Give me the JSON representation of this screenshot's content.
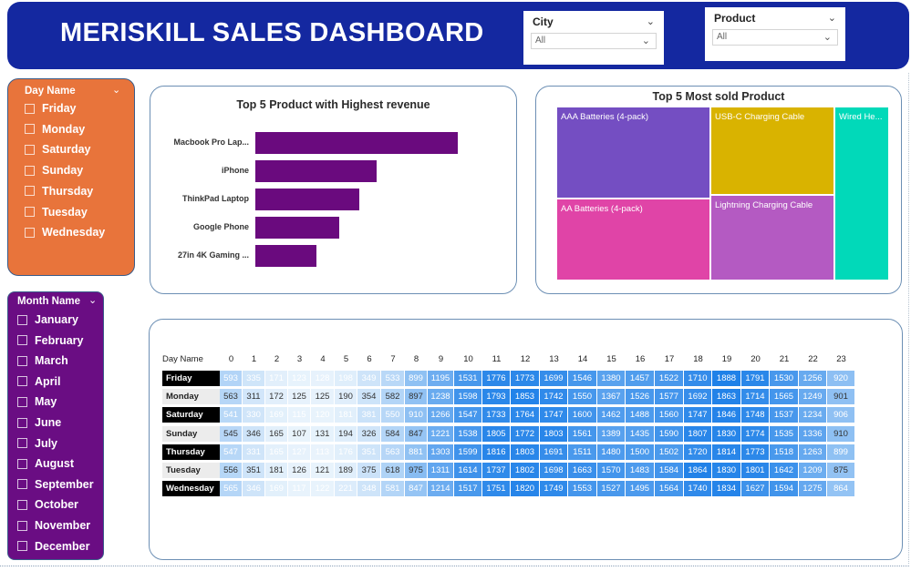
{
  "header": {
    "title": "MERISKILL SALES DASHBOARD"
  },
  "city_slicer": {
    "label": "City",
    "value": "All"
  },
  "product_slicer": {
    "label": "Product",
    "value": "All"
  },
  "day_slicer": {
    "title": "Day Name",
    "items": [
      "Friday",
      "Monday",
      "Saturday",
      "Sunday",
      "Thursday",
      "Tuesday",
      "Wednesday"
    ]
  },
  "month_slicer": {
    "title": "Month Name",
    "items": [
      "January",
      "February",
      "March",
      "April",
      "May",
      "June",
      "July",
      "August",
      "September",
      "October",
      "November",
      "December"
    ]
  },
  "bar_chart": {
    "title": "Top 5 Product with Highest revenue",
    "color": "#6a0a7e"
  },
  "treemap": {
    "title": "Top 5 Most sold Product"
  },
  "heatmap": {
    "corner_label": "Day Name"
  },
  "chart_data": [
    {
      "type": "bar",
      "title": "Top 5 Product with Highest revenue",
      "categories": [
        "Macbook Pro Lap...",
        "iPhone",
        "ThinkPad Laptop",
        "Google Phone",
        "27in 4K Gaming ..."
      ],
      "values": [
        8.0,
        4.8,
        4.1,
        3.3,
        2.4
      ],
      "xlim": [
        0,
        8.0
      ]
    },
    {
      "type": "treemap",
      "title": "Top 5 Most sold Product",
      "items": [
        {
          "name": "AAA Batteries (4-pack)",
          "color": "#744ec2"
        },
        {
          "name": "AA Batteries (4-pack)",
          "color": "#e044a7"
        },
        {
          "name": "USB-C Charging Cable",
          "color": "#d9b300"
        },
        {
          "name": "Lightning Charging Cable",
          "color": "#b45ac2"
        },
        {
          "name": "Wired He...",
          "color": "#01d9b9"
        }
      ]
    },
    {
      "type": "heatmap",
      "x": [
        "0",
        "1",
        "2",
        "3",
        "4",
        "5",
        "6",
        "7",
        "8",
        "9",
        "10",
        "11",
        "12",
        "13",
        "14",
        "15",
        "16",
        "17",
        "18",
        "19",
        "20",
        "21",
        "22",
        "23"
      ],
      "rows": [
        {
          "day": "Friday",
          "label_style": "dark",
          "values": [
            593,
            335,
            171,
            123,
            128,
            198,
            349,
            533,
            899,
            1195,
            1531,
            1776,
            1773,
            1699,
            1546,
            1380,
            1457,
            1522,
            1710,
            1888,
            1791,
            1530,
            1256,
            920
          ]
        },
        {
          "day": "Monday",
          "label_style": "light",
          "values": [
            563,
            311,
            172,
            125,
            125,
            190,
            354,
            582,
            897,
            1238,
            1598,
            1793,
            1853,
            1742,
            1550,
            1367,
            1526,
            1577,
            1692,
            1863,
            1714,
            1565,
            1249,
            901
          ]
        },
        {
          "day": "Saturday",
          "label_style": "dark",
          "values": [
            541,
            330,
            169,
            115,
            120,
            181,
            381,
            550,
            910,
            1266,
            1547,
            1733,
            1764,
            1747,
            1600,
            1462,
            1488,
            1560,
            1747,
            1846,
            1748,
            1537,
            1234,
            906
          ]
        },
        {
          "day": "Sunday",
          "label_style": "light",
          "values": [
            545,
            346,
            165,
            107,
            131,
            194,
            326,
            584,
            847,
            1221,
            1538,
            1805,
            1772,
            1803,
            1561,
            1389,
            1435,
            1590,
            1807,
            1830,
            1774,
            1535,
            1336,
            910
          ]
        },
        {
          "day": "Thursday",
          "label_style": "dark",
          "values": [
            547,
            331,
            165,
            127,
            113,
            176,
            351,
            563,
            881,
            1303,
            1599,
            1816,
            1803,
            1691,
            1511,
            1480,
            1500,
            1502,
            1720,
            1814,
            1773,
            1518,
            1263,
            899
          ]
        },
        {
          "day": "Tuesday",
          "label_style": "light",
          "values": [
            556,
            351,
            181,
            126,
            121,
            189,
            375,
            618,
            975,
            1311,
            1614,
            1737,
            1802,
            1698,
            1663,
            1570,
            1483,
            1584,
            1864,
            1830,
            1801,
            1642,
            1209,
            875
          ]
        },
        {
          "day": "Wednesday",
          "label_style": "dark",
          "values": [
            565,
            346,
            169,
            117,
            122,
            221,
            348,
            581,
            847,
            1214,
            1517,
            1751,
            1820,
            1749,
            1553,
            1527,
            1495,
            1564,
            1740,
            1834,
            1627,
            1594,
            1275,
            864
          ]
        }
      ],
      "range": [
        100,
        1900
      ]
    }
  ]
}
